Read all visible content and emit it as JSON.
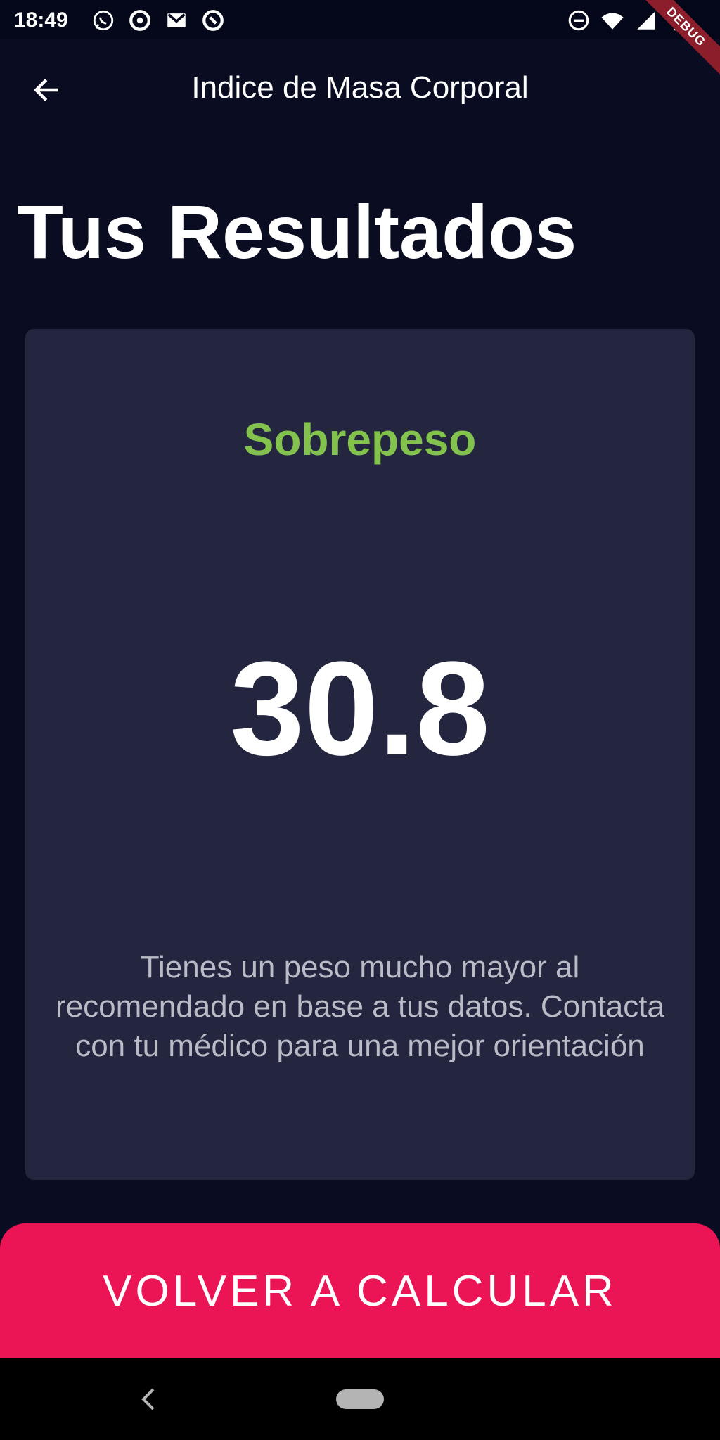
{
  "status_bar": {
    "time": "18:49",
    "left_icons": [
      "whatsapp-icon",
      "app-notification-icon",
      "gmail-icon",
      "app-notification-icon"
    ],
    "right_icons": [
      "do-not-disturb-icon",
      "wifi-icon",
      "cell-signal-icon",
      "battery-icon"
    ]
  },
  "debug_banner": "DEBUG",
  "app_bar": {
    "title": "Indice de Masa Corporal",
    "back_icon": "arrow-left-icon"
  },
  "page": {
    "title": "Tus Resultados"
  },
  "result": {
    "status": "Sobrepeso",
    "value": "30.8",
    "description": "Tienes un peso mucho mayor al recomendado en base a tus datos. Contacta con tu médico para una mejor orientación"
  },
  "button": {
    "label": "VOLVER A CALCULAR"
  },
  "colors": {
    "background": "#0A0D22",
    "card": "#24263F",
    "status_green": "#83C34D",
    "accent_pink": "#EB1555",
    "description_text": "#B9BBC6"
  }
}
